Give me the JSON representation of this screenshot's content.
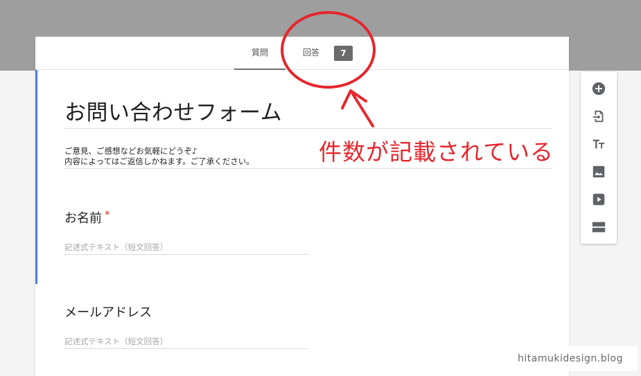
{
  "tabs": {
    "questions_label": "質問",
    "responses_label": "回答",
    "responses_count": "7"
  },
  "form": {
    "title": "お問い合わせフォーム",
    "description": "ご意見、ご感想などお気軽にどうぞ♪\n内容によってはご返信しかねます。ご了承ください。",
    "questions": [
      {
        "title": "お名前",
        "required_mark": "*",
        "placeholder": "記述式テキスト（短文回答）"
      },
      {
        "title": "メールアドレス",
        "placeholder": "記述式テキスト（短文回答）"
      }
    ]
  },
  "sidebar": {
    "tools": [
      "add-question-icon",
      "import-questions-icon",
      "add-title-icon",
      "add-image-icon",
      "add-video-icon",
      "add-section-icon"
    ]
  },
  "annotation": {
    "text": "件数が記載されている",
    "color": "#e5262d"
  },
  "watermark": "hitamukidesign.blog",
  "colors": {
    "top_band": "#9e9e9e",
    "focus_bar": "#4a7be6",
    "badge": "#6b6b6b",
    "required": "#d93025"
  }
}
